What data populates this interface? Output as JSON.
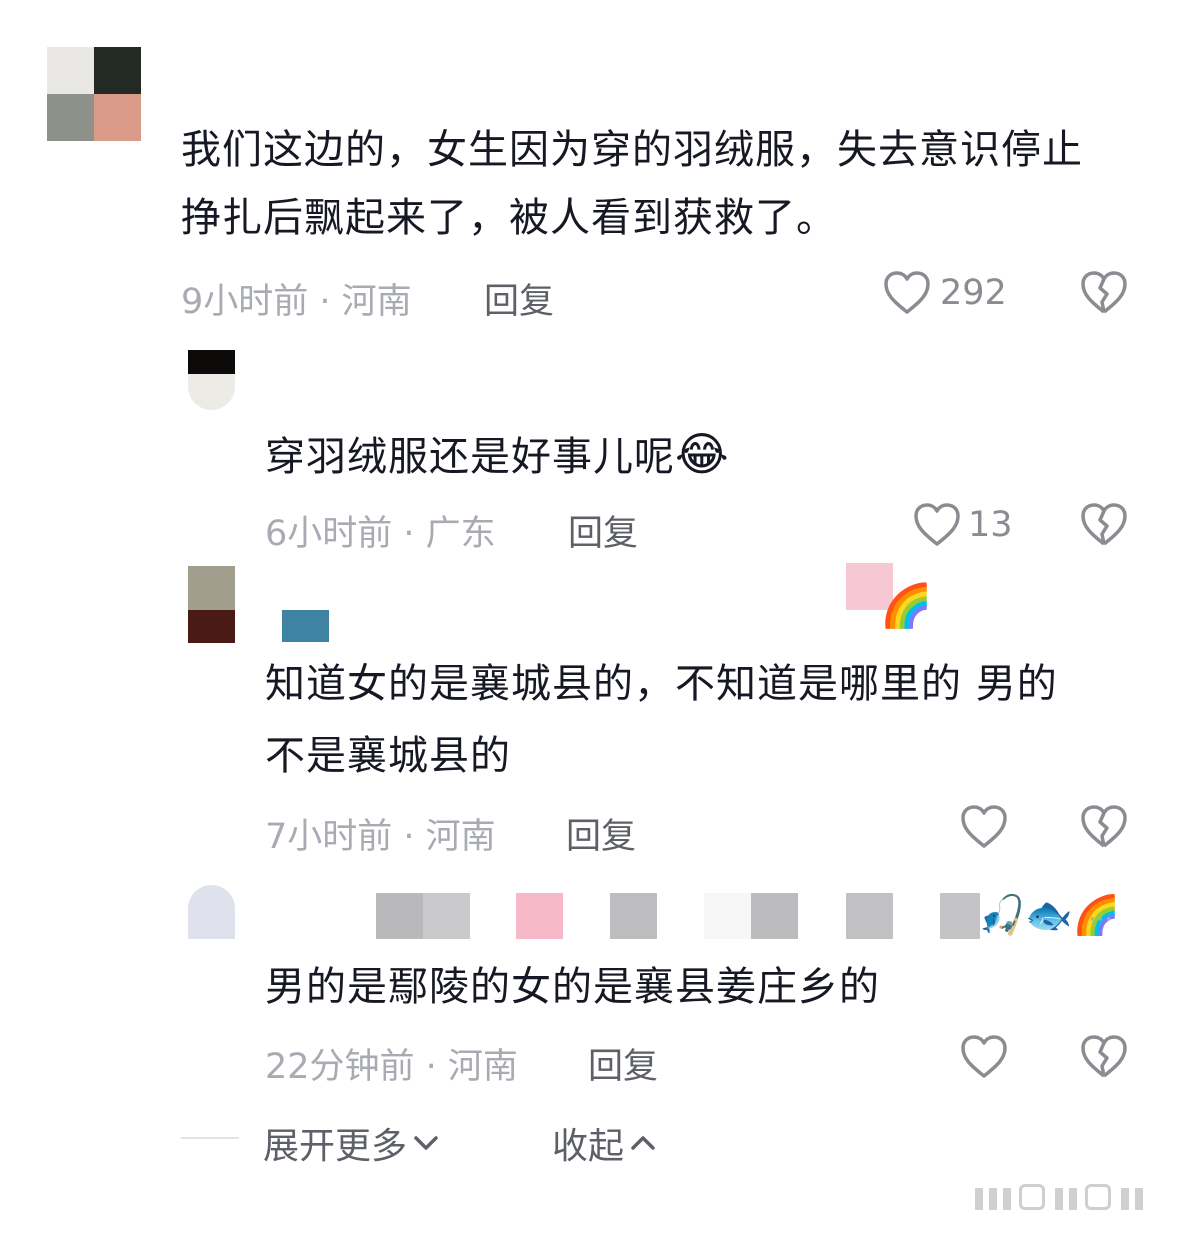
{
  "comments": [
    {
      "text": "我们这边的，女生因为穿的羽绒服，失去意识停止挣扎后飘起来了，被人看到获救了。",
      "time_location": "9小时前 · 河南",
      "reply_label": "回复",
      "likes": "292"
    },
    {
      "text": "穿羽绒服还是好事儿呢",
      "emoji": "😂",
      "time_location": "6小时前 · 广东",
      "reply_label": "回复",
      "likes": "13"
    },
    {
      "username_emoji": "🌈",
      "text_line1": "知道女的是襄城县的，不知道是哪里的 男的",
      "text_line2": "不是襄城县的",
      "time_location": "7小时前 · 河南",
      "reply_label": "回复"
    },
    {
      "username_emoji": "🎣🐟🌈",
      "more": "···",
      "text": "男的是鄢陵的女的是襄县姜庄乡的",
      "time_location": "22分钟前 · 河南",
      "reply_label": "回复"
    }
  ],
  "footer": {
    "expand_label": "展开更多",
    "collapse_label": "收起"
  },
  "colors": {
    "text": "#161823",
    "meta": "#a9abb2",
    "reply": "#5e6068"
  }
}
